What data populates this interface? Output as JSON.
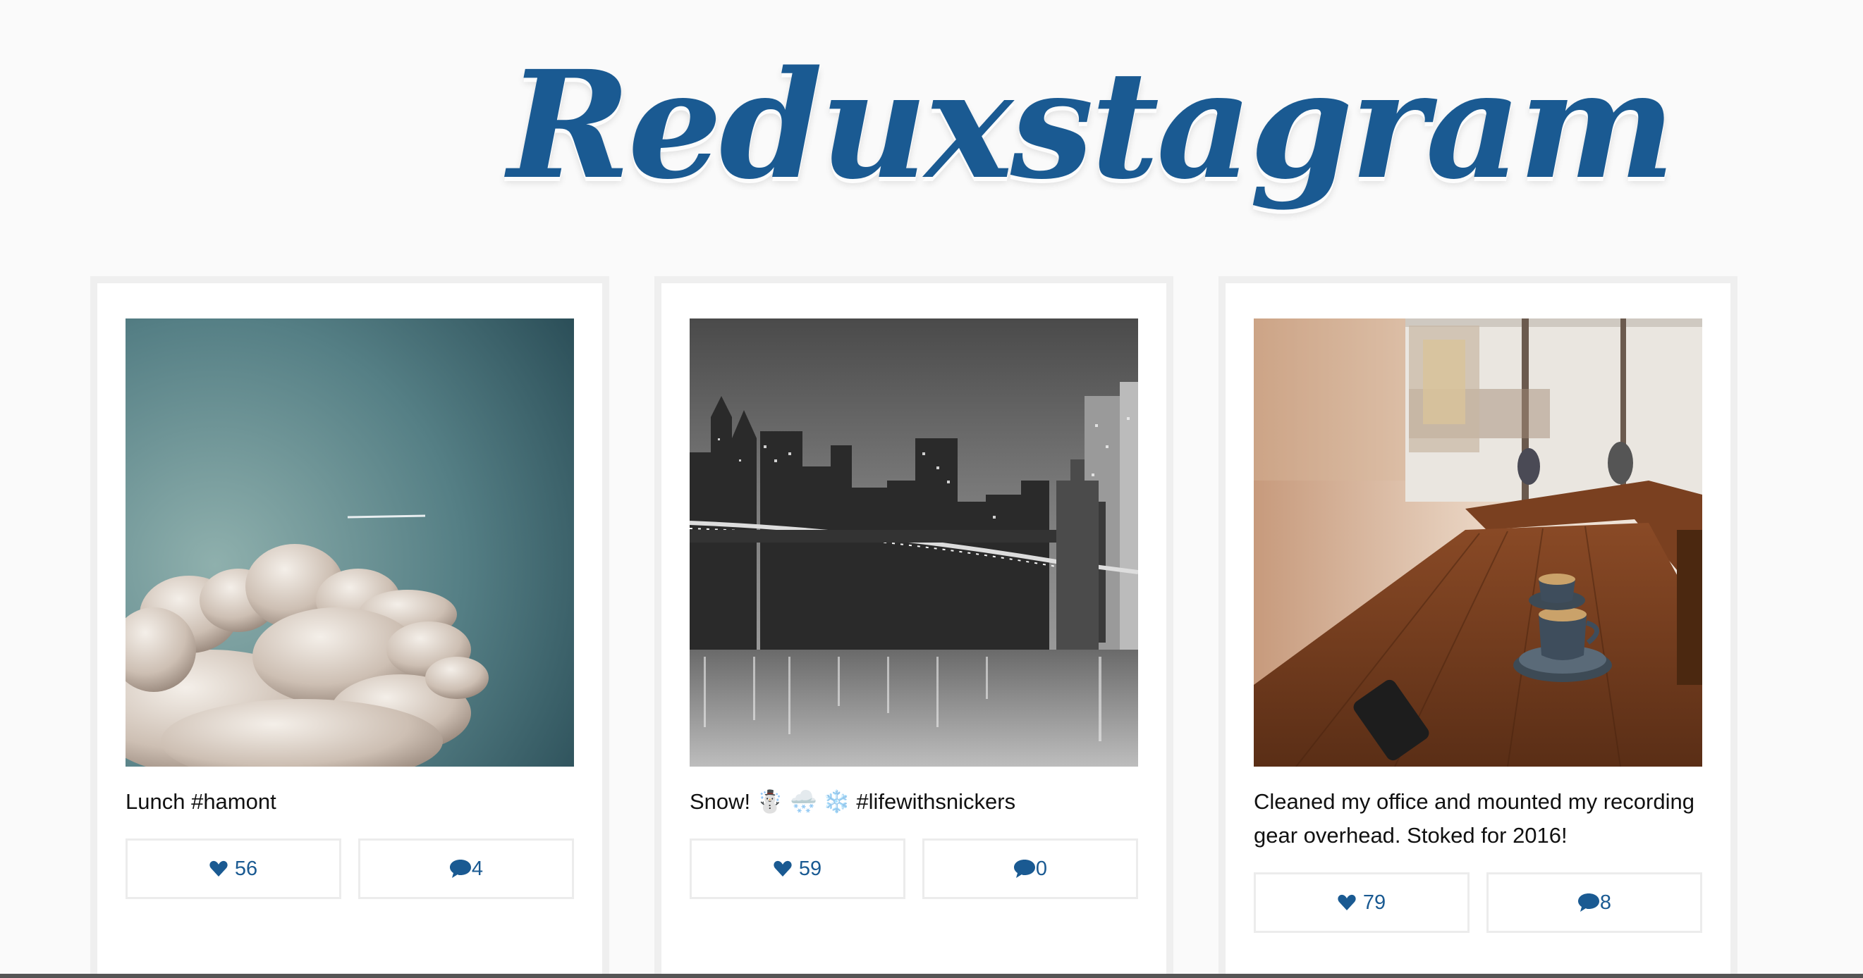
{
  "app": {
    "logo_text": "Reduxstagram",
    "brand_color": "#1a5a92"
  },
  "posts": [
    {
      "caption": "Lunch #hamont",
      "likes": "56",
      "comments": "4",
      "photo": "sky-with-cloud"
    },
    {
      "caption": "Snow! ☃️ 🌨️ ❄️  #lifewithsnickers",
      "likes": "59",
      "comments": "0",
      "photo": "city-skyline-bridge-night"
    },
    {
      "caption": "Cleaned my office and mounted my recording gear overhead. Stoked for 2016!",
      "likes": "79",
      "comments": "8",
      "photo": "cafe-table-coffee"
    }
  ],
  "icons": {
    "like": "heart-icon",
    "comment": "speech-bubble-icon"
  }
}
